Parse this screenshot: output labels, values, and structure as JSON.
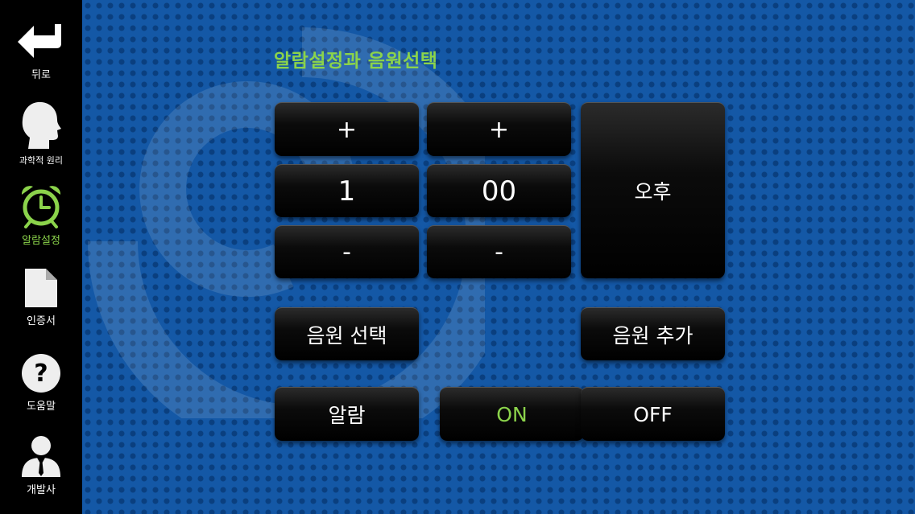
{
  "sidebar": {
    "items": [
      {
        "label": "뒤로",
        "icon": "back-arrow-icon"
      },
      {
        "label": "과학적 원리",
        "icon": "head-profile-icon"
      },
      {
        "label": "알람설정",
        "icon": "alarm-clock-icon",
        "active": true
      },
      {
        "label": "인증서",
        "icon": "document-icon"
      },
      {
        "label": "도움말",
        "icon": "help-icon"
      },
      {
        "label": "개발사",
        "icon": "person-icon"
      }
    ]
  },
  "main": {
    "title": "알람설정과 음원선택",
    "hour": {
      "plus_label": "+",
      "value": "1",
      "minus_label": "-"
    },
    "minute": {
      "plus_label": "+",
      "value": "00",
      "minus_label": "-"
    },
    "ampm": "오후",
    "sound_select_label": "음원 선택",
    "sound_add_label": "음원 추가",
    "alarm_label": "알람",
    "on_label": "ON",
    "off_label": "OFF"
  },
  "colors": {
    "accent": "#8bd34b",
    "background": "#1458a6",
    "dot": "#0a3f7f",
    "sidebar": "#000000",
    "button": "#0b0b0b"
  }
}
